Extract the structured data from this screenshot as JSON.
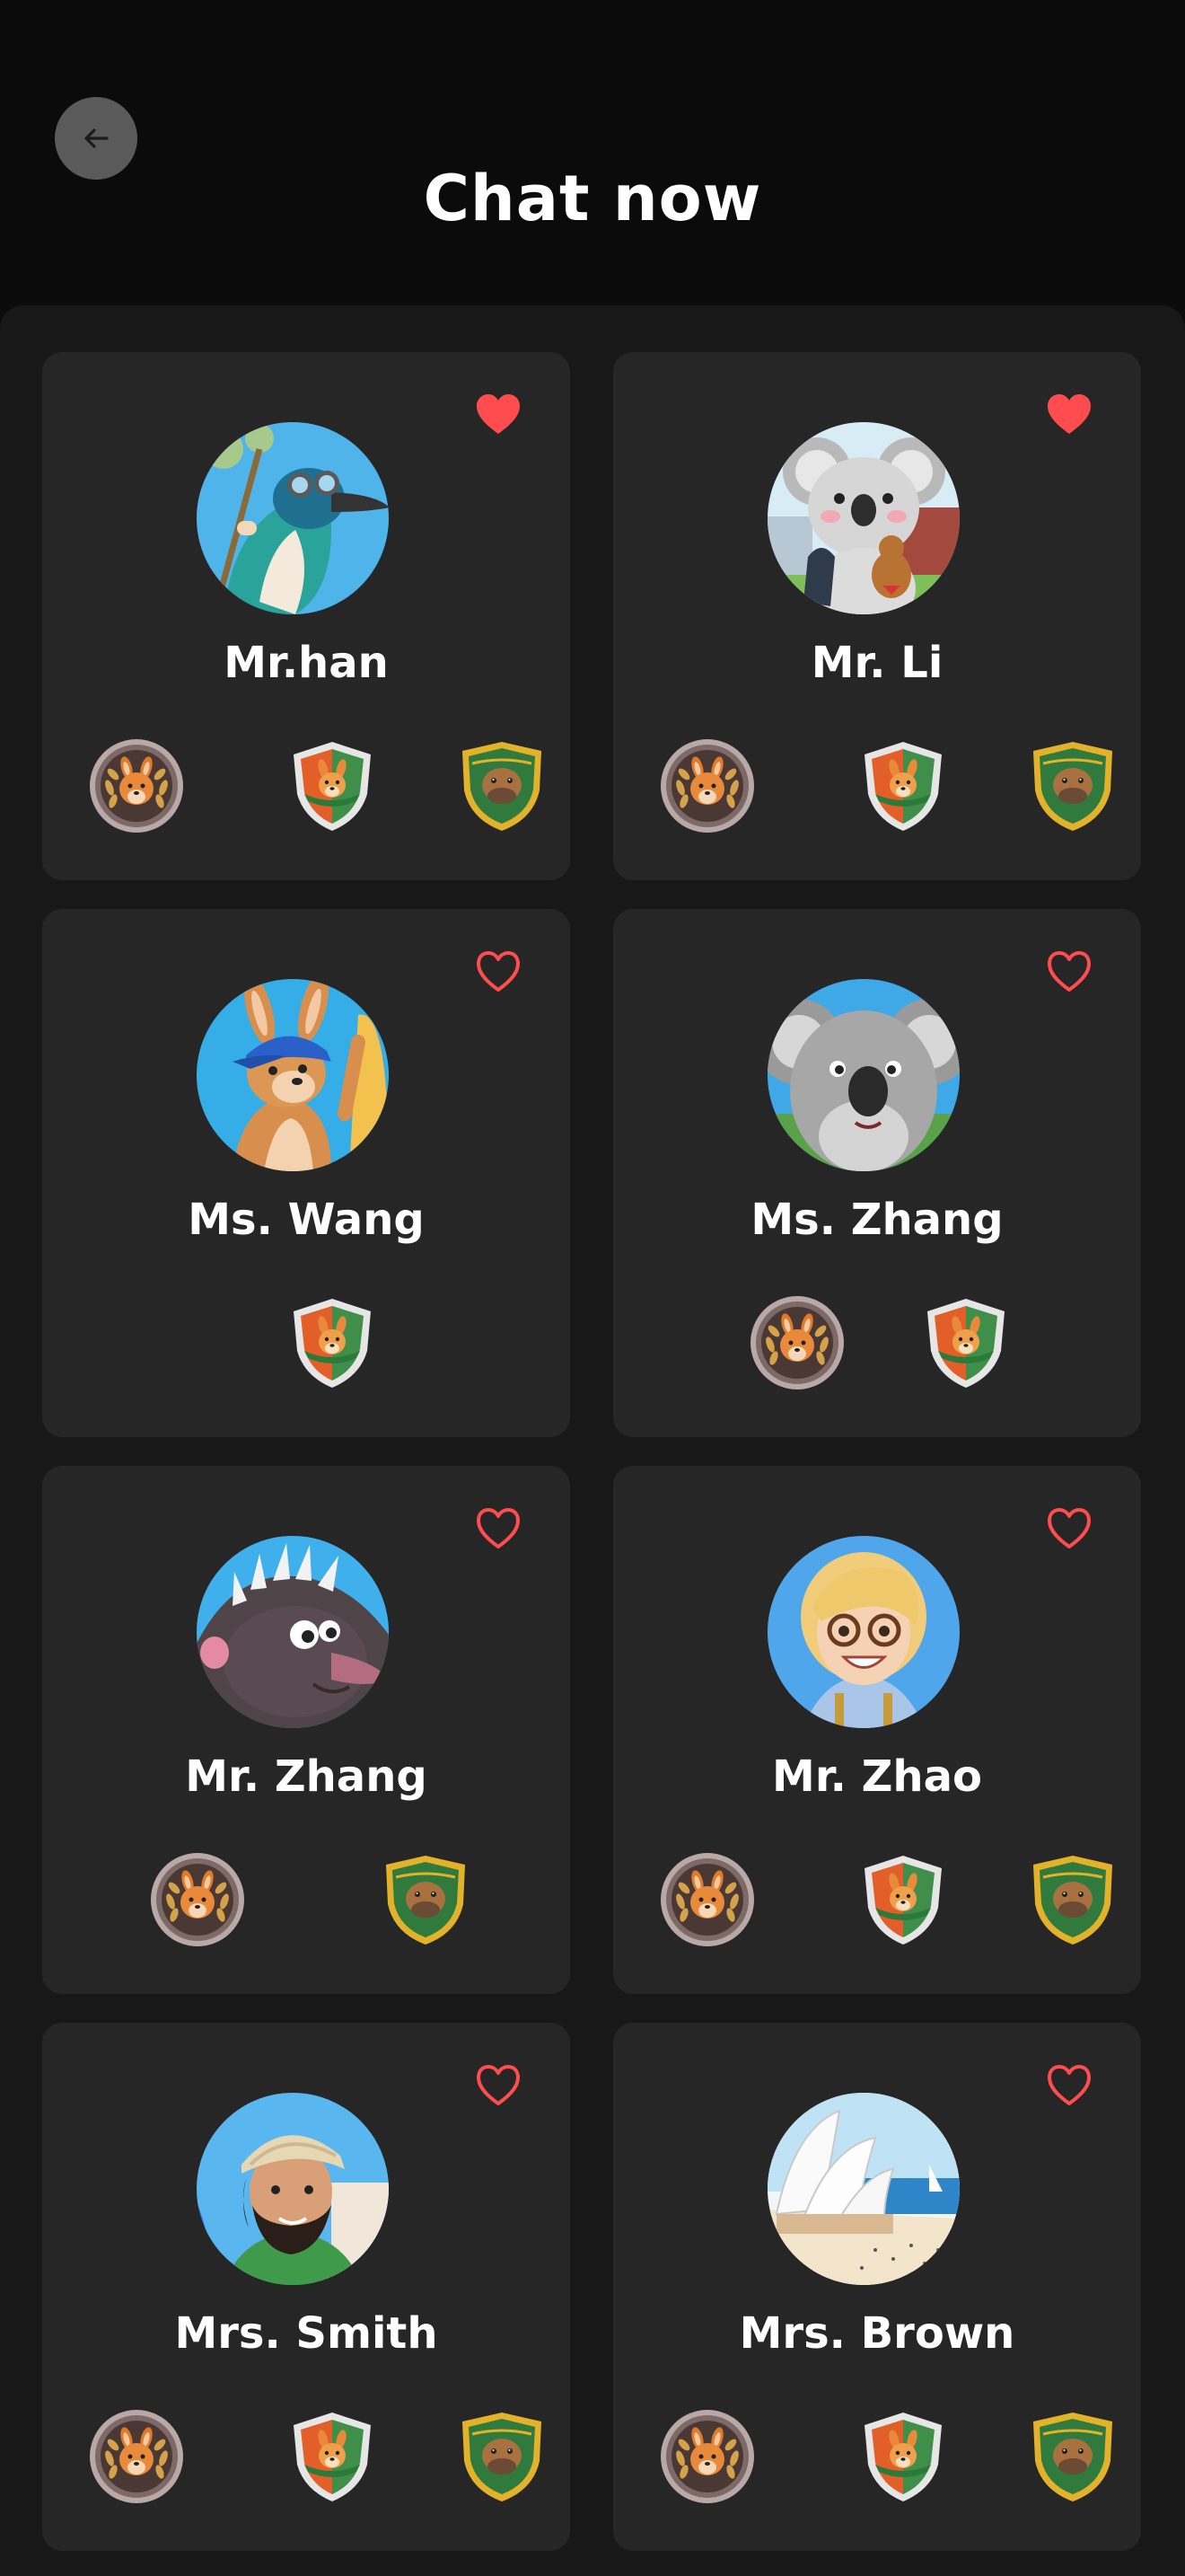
{
  "header": {
    "title": "Chat now",
    "back_icon": "arrow-left-icon"
  },
  "colors": {
    "background": "#0b0b0b",
    "panel": "#181818",
    "card": "#262626",
    "heart": "#ff4d4f",
    "back_button": "#5a5a5a"
  },
  "cards": [
    {
      "name": "Mr.han",
      "favorite": true,
      "avatar": "bird-with-goggles-avatar",
      "badges": [
        "kangaroo-coin-badge",
        "kangaroo-shield-badge",
        "platypus-shield-badge"
      ]
    },
    {
      "name": "Mr. Li",
      "favorite": true,
      "avatar": "koala-with-backpack-avatar",
      "badges": [
        "kangaroo-coin-badge",
        "kangaroo-shield-badge",
        "platypus-shield-badge"
      ]
    },
    {
      "name": "Ms. Wang",
      "favorite": false,
      "avatar": "kangaroo-with-cap-avatar",
      "badges": [
        "kangaroo-shield-badge"
      ]
    },
    {
      "name": "Ms. Zhang",
      "favorite": false,
      "avatar": "koala-avatar",
      "badges": [
        "kangaroo-coin-badge",
        "kangaroo-shield-badge"
      ]
    },
    {
      "name": "Mr. Zhang",
      "favorite": false,
      "avatar": "echidna-avatar",
      "badges": [
        "kangaroo-coin-badge",
        "platypus-shield-badge"
      ]
    },
    {
      "name": "Mr. Zhao",
      "favorite": false,
      "avatar": "woman-with-glasses-avatar",
      "badges": [
        "kangaroo-coin-badge",
        "kangaroo-shield-badge",
        "platypus-shield-badge"
      ]
    },
    {
      "name": "Mrs. Smith",
      "favorite": false,
      "avatar": "man-with-cap-avatar",
      "badges": [
        "kangaroo-coin-badge",
        "kangaroo-shield-badge",
        "platypus-shield-badge"
      ]
    },
    {
      "name": "Mrs. Brown",
      "favorite": false,
      "avatar": "sydney-opera-house-avatar",
      "badges": [
        "kangaroo-coin-badge",
        "kangaroo-shield-badge",
        "platypus-shield-badge"
      ]
    }
  ]
}
